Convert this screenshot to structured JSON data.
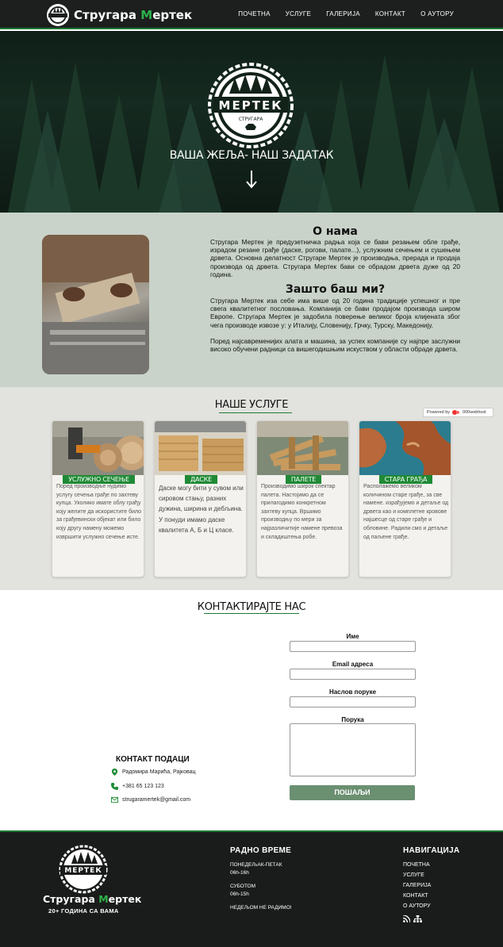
{
  "nav": {
    "brand_part1": "Стругара ",
    "brand_m": "М",
    "brand_part2": "ертек",
    "links": [
      "ПОЧЕТНА",
      "УСЛУГЕ",
      "ГАЛЕРИЈА",
      "КОНТАКТ",
      "О АУТОРУ"
    ]
  },
  "hero": {
    "emblem_text": "МЕРТЕК",
    "emblem_small": "СТРУГАРА",
    "slogan": "ВАША ЖЕЉА- НАШ ЗАДАТАК"
  },
  "about": {
    "title": "О нама",
    "text": "Стругара Мертек је предузетничка радња која се бави резањем обле грађе, израдом резане грађе (даске, рогови, палате...), услужним сечењем и сушењем дрвета. Основна делатност Стругаре Мертек је производња, прерада и продаја производа од дрвета. Стругара Мертек бави се обрадом дрвета дуже од 20 година.",
    "why_title": "Зашто баш ми?",
    "why_text1": "Стругара Мертек иза себе има више од 20 година традиције успешног и пре свега квалитетног пословања. Компанија се бави продајом производа широм Европе. Стругара Мертек је задобила поверење великог броја клијената због чега производе извозе у: у Италију, Словенију, Грчку, Турску, Македонију.",
    "why_text2": "Поред најсавременијих алата и машина, за успех компаније су најпре заслужни високо обучени радници са вишегодишњим искуством у области обраде дрвета."
  },
  "services": {
    "title": "НАШЕ УСЛУГЕ",
    "powered": "Powered by",
    "host": "000webhost",
    "cards": [
      {
        "label": "УСЛУЖНО СЕЧЕЊЕ",
        "text": "Поред производње нудимо услугу сечења грађе по захтеву купца. Уколико имате облу грађу коју желите да искористите било за грађевински објекат или било коју другу намену можемо извршити услужно сечење исте."
      },
      {
        "label": "ДАСКЕ",
        "text": "Даске могу бити у сувом или сировом стању, разних дужина, ширина и дебљина. У понуди имамо даске квалитета А, Б и Ц класе."
      },
      {
        "label": "ПАЛЕТЕ",
        "text": "Производимо широк спектар палета. Настојимо да се прилагодимо конкретном захтеву купца. Вршимо производњу по мери за најразличитије намене превоза и складиштења робе."
      },
      {
        "label": "СТАРА ГРАЂА",
        "text": "Располажемо великом количином старе грађе, за све намене. израђујемо и детаље од дрвета као и комплетне кровове најшесце од старе грађе и обловине. Радили смо и детаље од паљене грађе."
      }
    ]
  },
  "contact": {
    "title": "КОНТАКТИРАЈТЕ НАС",
    "form": {
      "name_label": "Име",
      "email_label": "Email адреса",
      "subject_label": "Наслов поруке",
      "message_label": "Порука",
      "submit": "ПОШАЉИ"
    },
    "info": {
      "title": "КОНТАКТ ПОДАЦИ",
      "address": "Радомира Марића, Рајковац",
      "phone": "+381 65 123 123",
      "email": "strugaramertek@gmail.com"
    }
  },
  "footer": {
    "emblem_text": "МЕРТЕК",
    "brand_part1": "Стругара ",
    "brand_m": "М",
    "brand_part2": "ертек",
    "sub": "20+ ГОДИНА СА ВАМА",
    "hours_title": "РАДНО ВРЕМЕ",
    "weekday_label": "ПОНЕДЕЉАК-ПЕТАК",
    "weekday_hours": "06h-16h",
    "saturday_label": "СУБОТОМ",
    "saturday_hours": "06h-15h",
    "sunday": "НЕДЕЉОМ НЕ РАДИМО!",
    "nav_title": "НАВИГАЦИЈА",
    "nav_links": [
      "ПОЧЕТНА",
      "УСЛУГЕ",
      "ГАЛЕРИЈА",
      "КОНТАКТ",
      "О АУТОРУ"
    ]
  },
  "colors": {
    "accent": "#1f8a35",
    "brand_green": "#2fb24c",
    "dark": "#1a1c1b",
    "about_bg": "#c9d3c9",
    "services_bg": "#e2e2df",
    "button": "#6b8f71"
  },
  "icons": [
    "saw-blade-logo",
    "arrow-down-icon",
    "map-pin-icon",
    "phone-icon",
    "mail-icon",
    "rss-icon",
    "sitemap-icon"
  ]
}
